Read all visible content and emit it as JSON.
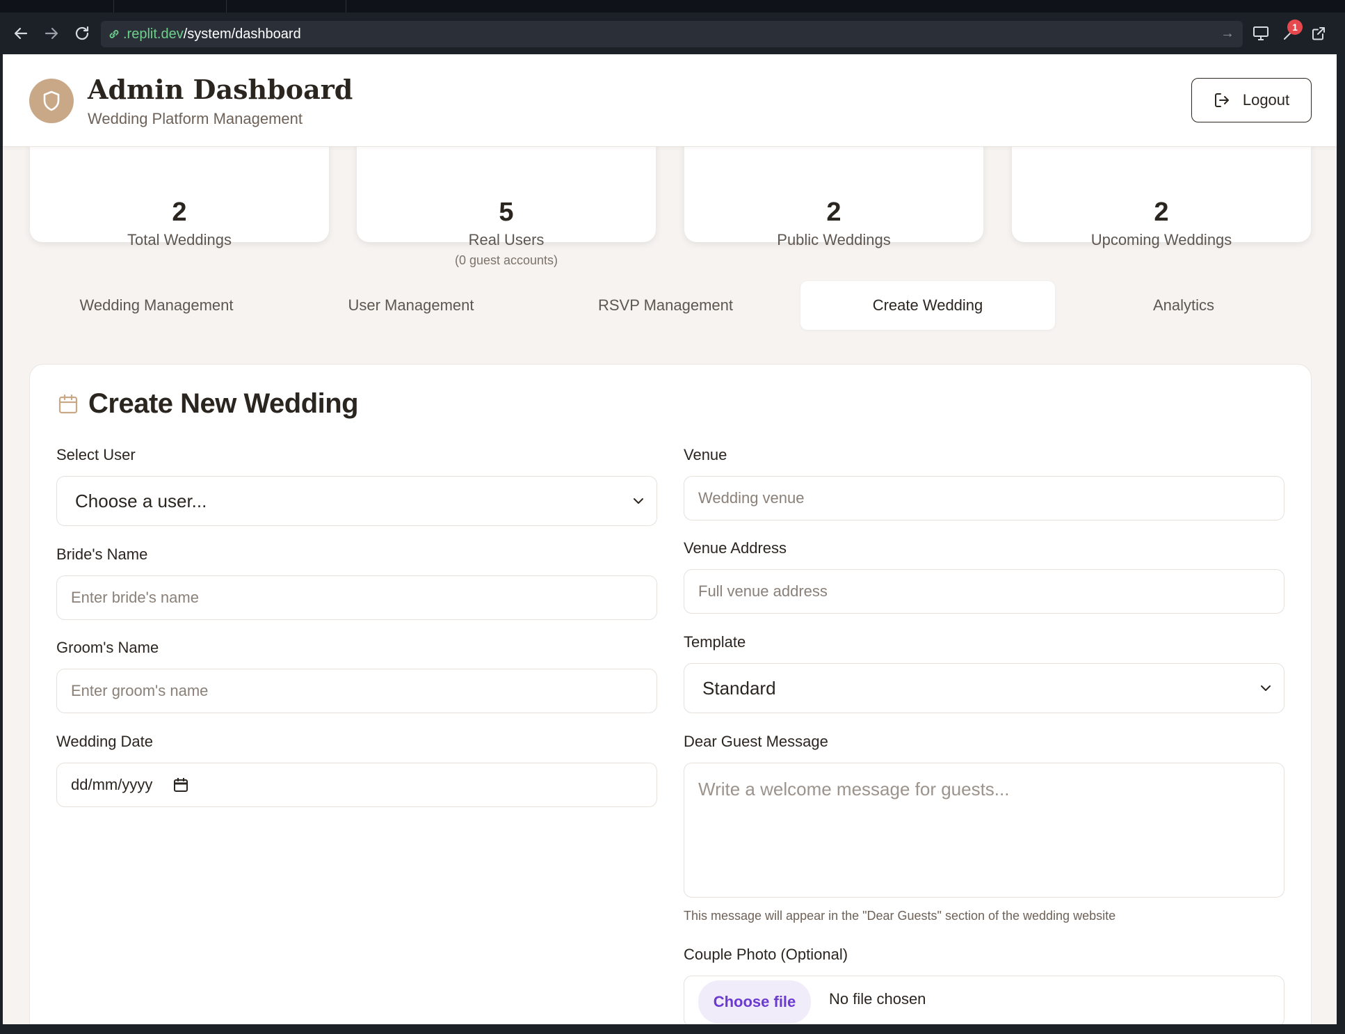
{
  "browser": {
    "url_host": ".replit.dev",
    "url_path": "/system/dashboard",
    "notification_count": "1"
  },
  "header": {
    "title": "Admin Dashboard",
    "subtitle": "Wedding Platform Management",
    "logout_label": "Logout"
  },
  "stats": [
    {
      "value": "2",
      "label": "Total Weddings",
      "sub": ""
    },
    {
      "value": "5",
      "label": "Real Users",
      "sub": "(0 guest accounts)"
    },
    {
      "value": "2",
      "label": "Public Weddings",
      "sub": ""
    },
    {
      "value": "2",
      "label": "Upcoming Weddings",
      "sub": ""
    }
  ],
  "tabs": [
    {
      "label": "Wedding Management"
    },
    {
      "label": "User Management"
    },
    {
      "label": "RSVP Management"
    },
    {
      "label": "Create Wedding"
    },
    {
      "label": "Analytics"
    }
  ],
  "form": {
    "title": "Create New Wedding",
    "select_user_label": "Select User",
    "select_user_value": "Choose a user...",
    "bride_label": "Bride's Name",
    "bride_placeholder": "Enter bride's name",
    "groom_label": "Groom's Name",
    "groom_placeholder": "Enter groom's name",
    "date_label": "Wedding Date",
    "date_placeholder": "dd/mm/yyyy",
    "venue_label": "Venue",
    "venue_placeholder": "Wedding venue",
    "venue_address_label": "Venue Address",
    "venue_address_placeholder": "Full venue address",
    "template_label": "Template",
    "template_value": "Standard",
    "message_label": "Dear Guest Message",
    "message_placeholder": "Write a welcome message for guests...",
    "message_help": "This message will appear in the \"Dear Guests\" section of the wedding website",
    "photo_label": "Couple Photo (Optional)",
    "choose_file_label": "Choose file",
    "no_file_label": "No file chosen"
  },
  "colors": {
    "accent": "#c9a888",
    "background": "#f6f3f0",
    "file_button": "#6b3ad1"
  }
}
